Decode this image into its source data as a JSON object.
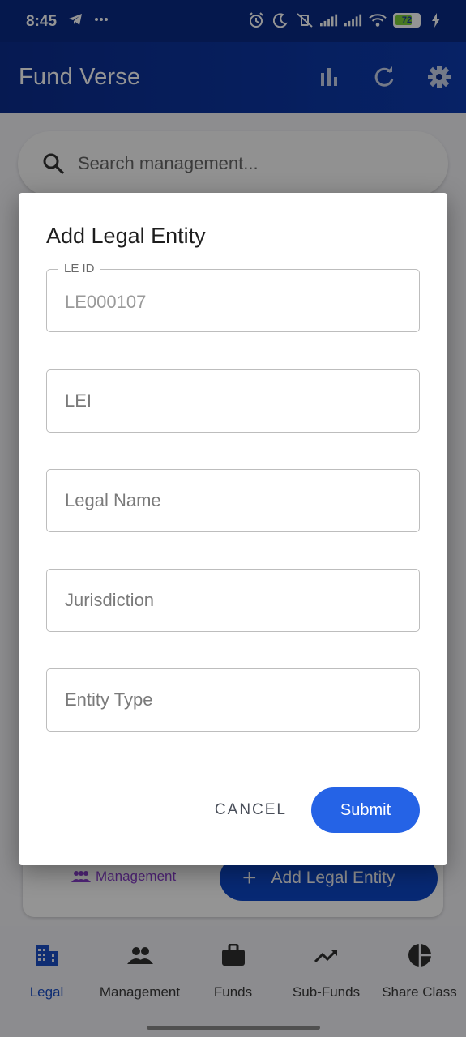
{
  "status_bar": {
    "time": "8:45",
    "left_icons": [
      "telegram-icon",
      "more-dots-icon"
    ],
    "right_icons": [
      "alarm-icon",
      "moon-icon",
      "silent-icon",
      "signal-icon",
      "signal-icon",
      "wifi-icon",
      "battery-icon",
      "charging-icon"
    ],
    "battery_percent": "72",
    "battery_level": 0.72
  },
  "app_bar": {
    "title": "Fund Verse",
    "actions": [
      "bar-chart-icon",
      "refresh-icon",
      "settings-icon"
    ]
  },
  "search": {
    "placeholder": "Search management..."
  },
  "card": {
    "management_label": "Management",
    "add_button_label": "Add Legal Entity"
  },
  "dialog": {
    "title": "Add Legal Entity",
    "fields": [
      {
        "label": "LE ID",
        "value": "LE000107"
      },
      {
        "placeholder": "LEI"
      },
      {
        "placeholder": "Legal Name"
      },
      {
        "placeholder": "Jurisdiction"
      },
      {
        "placeholder": "Entity Type"
      }
    ],
    "cancel_label": "CANCEL",
    "submit_label": "Submit"
  },
  "bottom_nav": {
    "items": [
      {
        "label": "Legal",
        "icon": "building-icon",
        "active": true
      },
      {
        "label": "Management",
        "icon": "people-icon"
      },
      {
        "label": "Funds",
        "icon": "briefcase-icon"
      },
      {
        "label": "Sub-Funds",
        "icon": "trending-up-icon"
      },
      {
        "label": "Share Class",
        "icon": "pie-chart-icon"
      }
    ]
  },
  "colors": {
    "primary": "#0d3bb0",
    "accent": "#2563e6",
    "active_nav": "#1a4fc7",
    "management_purple": "#8a3fcf"
  }
}
